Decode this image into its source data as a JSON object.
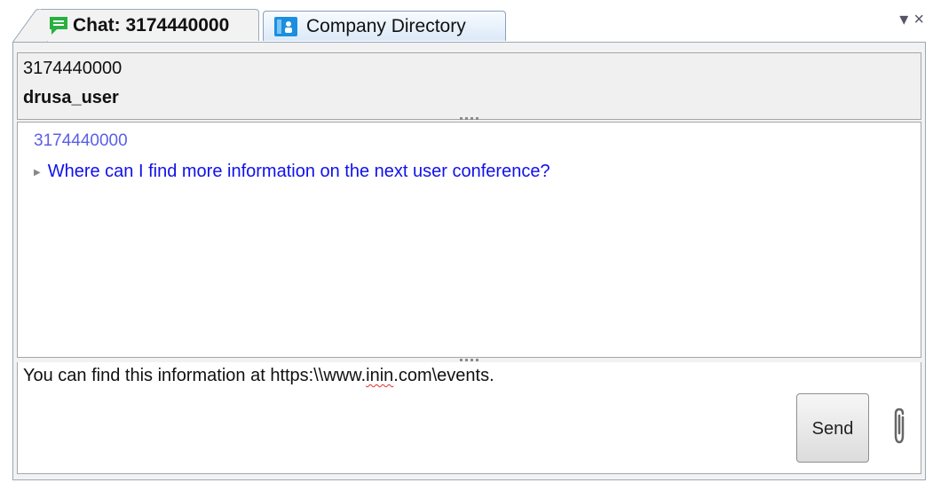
{
  "tabs": [
    {
      "label": "Chat: 3174440000",
      "icon": "chat-icon",
      "active": true
    },
    {
      "label": "Company Directory",
      "icon": "directory-icon",
      "active": false
    }
  ],
  "window_controls": {
    "dropdown_glyph": "▾",
    "close_glyph": "×"
  },
  "header": {
    "line1": "3174440000",
    "line2": "drusa_user"
  },
  "transcript": {
    "messages": [
      {
        "sender": "3174440000",
        "text": "Where can I find more information on the next user conference?"
      }
    ]
  },
  "compose": {
    "text_before": "You can find this information at https:\\\\www.",
    "misspelled": "inin",
    "text_after": ".com\\events.",
    "send_label": "Send",
    "attach_icon": "paperclip-icon"
  },
  "colors": {
    "chat_icon": "#28b040",
    "directory_icon": "#1a8fe0",
    "sender": "#5a5fe8",
    "message": "#1010ee",
    "spellcheck": "#e03030"
  }
}
